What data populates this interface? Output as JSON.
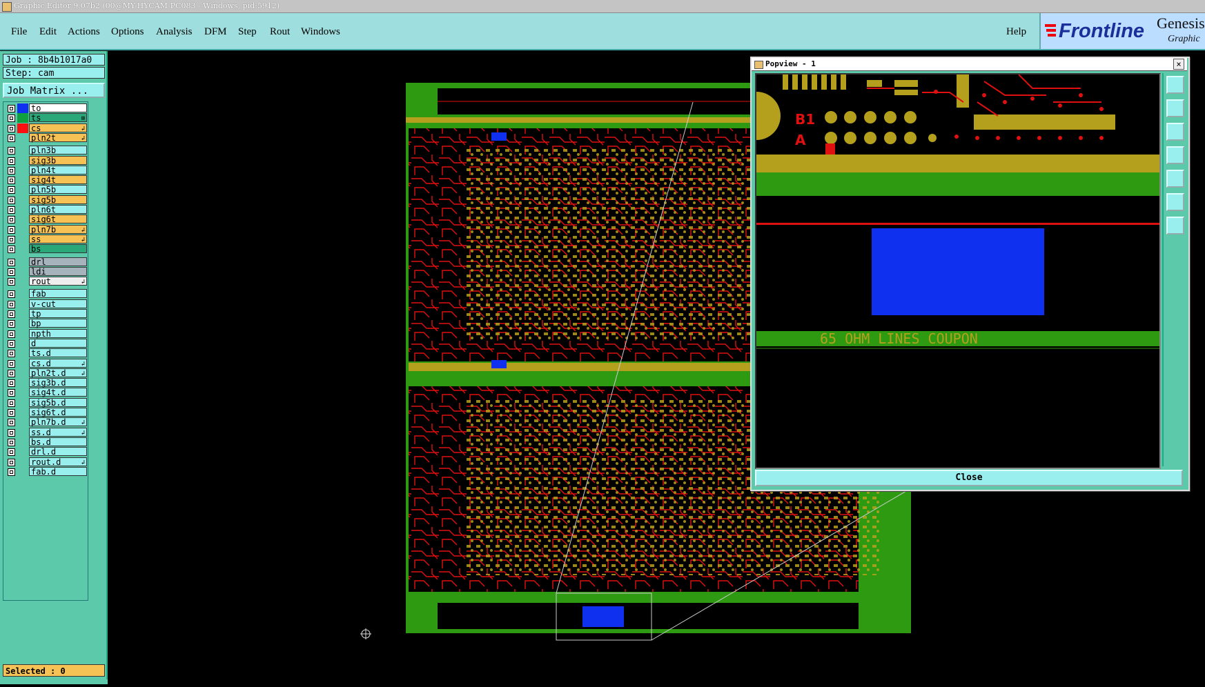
{
  "window": {
    "title": "Graphic Editor 9.07b2 (00@MY-HYCAM-PC083 - Windows, pid:5912)"
  },
  "menu": {
    "items": [
      "File",
      "Edit",
      "Actions",
      "Options",
      "Analysis",
      "DFM",
      "Step",
      "Rout",
      "Windows"
    ],
    "help": "Help"
  },
  "logo": {
    "brand": "Frontline",
    "product": "Genesis",
    "subtitle": "Graphic"
  },
  "job": {
    "job_text": "Job : 8b4b1017a0",
    "step_text": "Step: cam",
    "matrix_button": "Job Matrix ..."
  },
  "layers": [
    {
      "name": "to",
      "color": "#1030f0",
      "bg": "#ffffff",
      "edit": ""
    },
    {
      "name": "ts",
      "color": "#11a040",
      "bg": "#2aa87a",
      "edit": "⊞"
    },
    {
      "name": "cs",
      "color": "#ff1010",
      "bg": "#f6c255",
      "edit": "↲"
    },
    {
      "name": "pln2t",
      "color": "",
      "bg": "#f6c255",
      "edit": "↲"
    },
    {
      "name": "pln3b",
      "color": "",
      "bg": "#9ee",
      "edit": ""
    },
    {
      "name": "sig3b",
      "color": "",
      "bg": "#f6c255",
      "edit": ""
    },
    {
      "name": "pln4t",
      "color": "",
      "bg": "#9ee",
      "edit": ""
    },
    {
      "name": "sig4t",
      "color": "",
      "bg": "#f6c255",
      "edit": ""
    },
    {
      "name": "pln5b",
      "color": "",
      "bg": "#9ee",
      "edit": ""
    },
    {
      "name": "sig5b",
      "color": "",
      "bg": "#f6c255",
      "edit": ""
    },
    {
      "name": "pln6t",
      "color": "",
      "bg": "#9ee",
      "edit": ""
    },
    {
      "name": "sig6t",
      "color": "",
      "bg": "#f6c255",
      "edit": ""
    },
    {
      "name": "pln7b",
      "color": "",
      "bg": "#f6c255",
      "edit": "↲"
    },
    {
      "name": "ss",
      "color": "",
      "bg": "#f6c255",
      "edit": "↲"
    },
    {
      "name": "bs",
      "color": "",
      "bg": "#2aa87a",
      "edit": ""
    },
    {
      "name": "drl",
      "color": "",
      "bg": "#a6b3bd",
      "edit": ""
    },
    {
      "name": "ldi",
      "color": "",
      "bg": "#a6b3bd",
      "edit": ""
    },
    {
      "name": "rout",
      "color": "",
      "bg": "#eeeeee",
      "edit": "↲"
    },
    {
      "name": "fab",
      "color": "",
      "bg": "#9ee",
      "edit": ""
    },
    {
      "name": "v-cut",
      "color": "",
      "bg": "#9ee",
      "edit": ""
    },
    {
      "name": "tp",
      "color": "",
      "bg": "#9ee",
      "edit": ""
    },
    {
      "name": "bp",
      "color": "",
      "bg": "#9ee",
      "edit": ""
    },
    {
      "name": "npth",
      "color": "",
      "bg": "#9ee",
      "edit": ""
    },
    {
      "name": "d",
      "color": "",
      "bg": "#9ee",
      "edit": ""
    },
    {
      "name": "ts.d",
      "color": "",
      "bg": "#9ee",
      "edit": ""
    },
    {
      "name": "cs.d",
      "color": "",
      "bg": "#9ee",
      "edit": "↲"
    },
    {
      "name": "pln2t.d",
      "color": "",
      "bg": "#9ee",
      "edit": "↲"
    },
    {
      "name": "sig3b.d",
      "color": "",
      "bg": "#9ee",
      "edit": ""
    },
    {
      "name": "sig4t.d",
      "color": "",
      "bg": "#9ee",
      "edit": ""
    },
    {
      "name": "sig5b.d",
      "color": "",
      "bg": "#9ee",
      "edit": ""
    },
    {
      "name": "sig6t.d",
      "color": "",
      "bg": "#9ee",
      "edit": ""
    },
    {
      "name": "pln7b.d",
      "color": "",
      "bg": "#9ee",
      "edit": "↲"
    },
    {
      "name": "ss.d",
      "color": "",
      "bg": "#9ee",
      "edit": "↲"
    },
    {
      "name": "bs.d",
      "color": "",
      "bg": "#9ee",
      "edit": ""
    },
    {
      "name": "drl.d",
      "color": "",
      "bg": "#9ee",
      "edit": ""
    },
    {
      "name": "rout.d",
      "color": "",
      "bg": "#9ee",
      "edit": "↲"
    },
    {
      "name": "fab.d",
      "color": "",
      "bg": "#9ee",
      "edit": ""
    }
  ],
  "status": {
    "selected": "Selected : 0"
  },
  "popview": {
    "title": "Popview - 1",
    "close_button": "Close",
    "pad_labels": [
      "B1",
      "A"
    ],
    "coupon_text": "65 OHM LINES COUPON"
  },
  "colors": {
    "board_green": "#2e9a12",
    "copper_gold": "#b5a01e",
    "trace_red": "#e01010",
    "highlight_blue": "#1030f0"
  }
}
